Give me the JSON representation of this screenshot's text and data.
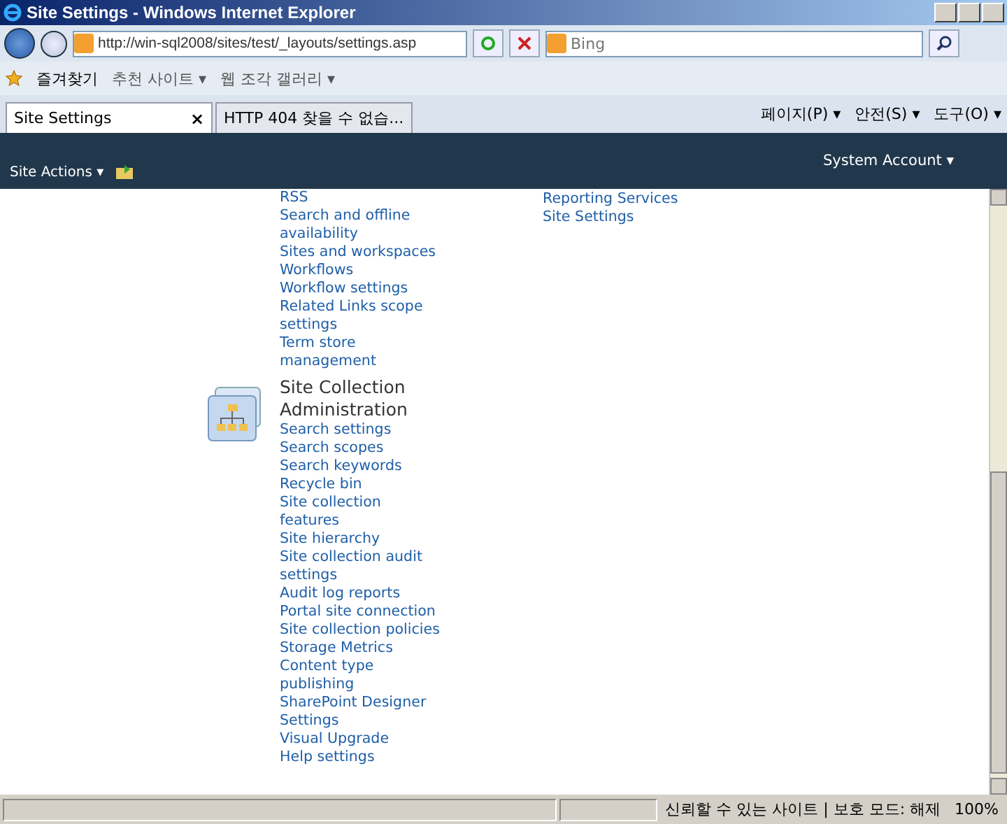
{
  "window": {
    "title": "Site Settings - Windows Internet Explorer"
  },
  "address_bar": {
    "url": "http://win-sql2008/sites/test/_layouts/settings.asp"
  },
  "search": {
    "placeholder": "Bing"
  },
  "favorites_bar": {
    "label": "즐겨찾기",
    "items": [
      {
        "label": "추천 사이트 ▾"
      },
      {
        "label": "웹 조각 갤러리 ▾"
      }
    ]
  },
  "tabs": [
    {
      "label": "Site Settings",
      "selected": true,
      "close": "×"
    },
    {
      "label": "HTTP 404 찾을 수 없습...",
      "selected": false
    }
  ],
  "command_bar": [
    {
      "label": "페이지(P) ▾"
    },
    {
      "label": "안전(S) ▾"
    },
    {
      "label": "도구(O) ▾"
    }
  ],
  "ribbon": {
    "site_actions": "Site Actions ▾",
    "user": "System Account ▾"
  },
  "sections": [
    {
      "links": [
        "RSS",
        "Search and offline availability",
        "Sites and workspaces",
        "Workflows",
        "Workflow settings",
        "Related Links scope settings",
        "Term store management"
      ]
    },
    {
      "title": "Site Collection Administration",
      "links": [
        "Search settings",
        "Search scopes",
        "Search keywords",
        "Recycle bin",
        "Site collection features",
        "Site hierarchy",
        "Site collection audit settings",
        "Audit log reports",
        "Portal site connection",
        "Site collection policies",
        "Storage Metrics",
        "Content type publishing",
        "SharePoint Designer Settings",
        "Visual Upgrade",
        "Help settings"
      ]
    }
  ],
  "right_links": [
    "Reporting Services",
    "Site Settings"
  ],
  "status_bar": {
    "zone": "신뢰할 수 있는 사이트 | 보호 모드: 해제",
    "zoom": "100%"
  }
}
